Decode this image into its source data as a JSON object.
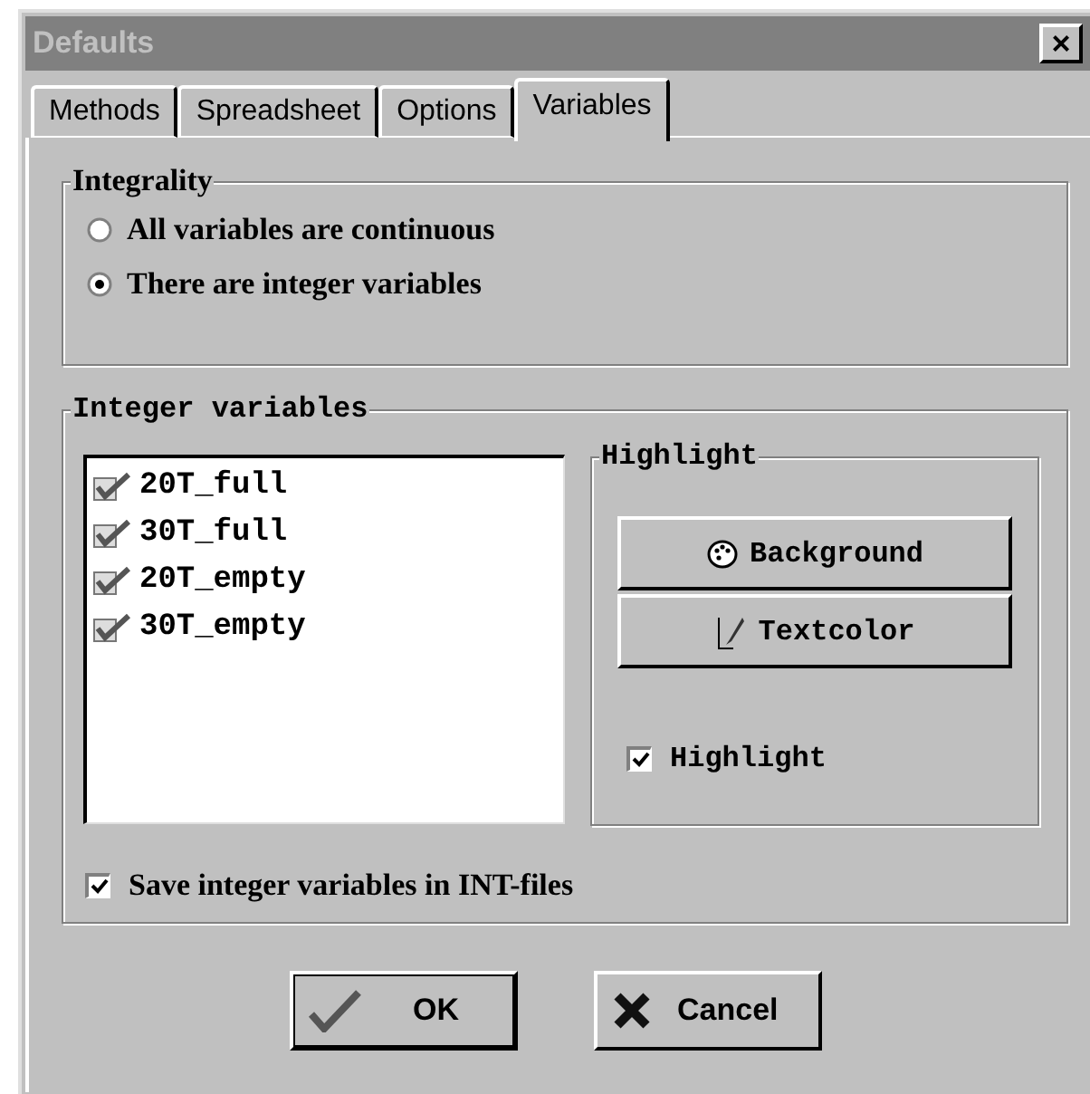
{
  "window": {
    "title": "Defaults",
    "close": "×"
  },
  "tabs": [
    {
      "label": "Methods",
      "selected": false
    },
    {
      "label": "Spreadsheet",
      "selected": false
    },
    {
      "label": "Options",
      "selected": false
    },
    {
      "label": "Variables",
      "selected": true
    }
  ],
  "integrality": {
    "title": "Integrality",
    "options": [
      {
        "label": "All variables are continuous",
        "selected": false
      },
      {
        "label": "There are integer variables",
        "selected": true
      }
    ]
  },
  "integer_variables": {
    "title": "Integer variables",
    "items": [
      {
        "label": "20T_full",
        "checked": true
      },
      {
        "label": "30T_full",
        "checked": true
      },
      {
        "label": "20T_empty",
        "checked": true
      },
      {
        "label": "30T_empty",
        "checked": true
      }
    ],
    "highlight": {
      "title": "Highlight",
      "buttons": [
        {
          "label": "Background",
          "kind": "palette"
        },
        {
          "label": "Textcolor",
          "kind": "brush"
        }
      ],
      "checkbox": {
        "label": "Highlight",
        "checked": true
      }
    },
    "save_checkbox": {
      "label": "Save integer variables in INT-files",
      "checked": true
    }
  },
  "buttons": [
    {
      "label": "OK",
      "kind": "ok"
    },
    {
      "label": "Cancel",
      "kind": "cancel"
    }
  ]
}
